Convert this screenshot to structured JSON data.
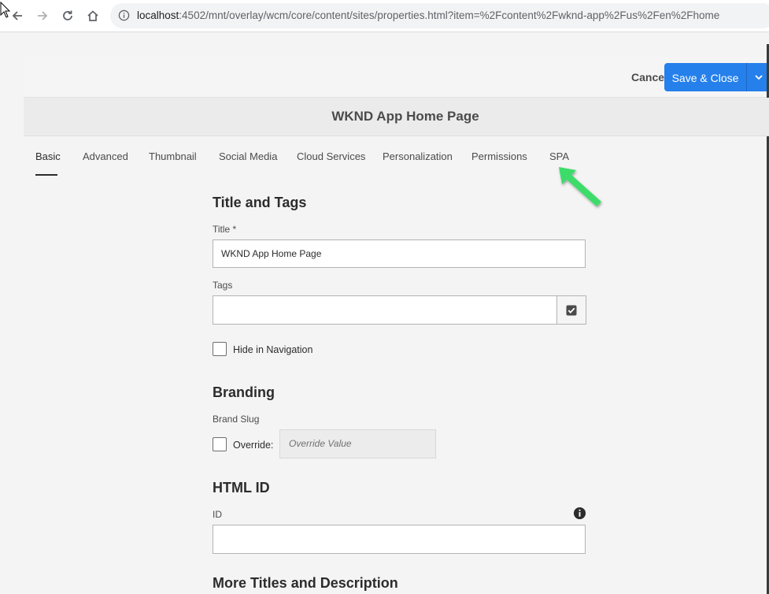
{
  "browser": {
    "url_host": "localhost",
    "url_path": ":4502/mnt/overlay/wcm/core/content/sites/properties.html?item=%2Fcontent%2Fwknd-app%2Fus%2Fen%2Fhome",
    "icons": [
      "back-icon",
      "forward-icon",
      "reload-icon",
      "home-icon",
      "info-icon"
    ]
  },
  "header": {
    "cancel_label": "Cancel",
    "save_label": "Save & Close",
    "page_title": "WKND App Home Page",
    "accent_color": "#2680eb"
  },
  "tabs": [
    {
      "label": "Basic",
      "active": true
    },
    {
      "label": "Advanced"
    },
    {
      "label": "Thumbnail"
    },
    {
      "label": "Social Media"
    },
    {
      "label": "Cloud Services"
    },
    {
      "label": "Personalization"
    },
    {
      "label": "Permissions"
    },
    {
      "label": "SPA"
    }
  ],
  "annotation": {
    "arrow_color": "#3ddc6b",
    "points_to": "SPA"
  },
  "form": {
    "title_and_tags": {
      "heading": "Title and Tags",
      "title_label": "Title *",
      "title_value": "WKND App Home Page",
      "tags_label": "Tags",
      "tags_value": "",
      "hide_in_nav_label": "Hide in Navigation",
      "hide_in_nav_checked": false
    },
    "branding": {
      "heading": "Branding",
      "brand_slug_label": "Brand Slug",
      "override_label": "Override:",
      "override_checked": false,
      "override_placeholder": "Override Value"
    },
    "html_id": {
      "heading": "HTML ID",
      "id_label": "ID",
      "id_value": ""
    },
    "more_titles": {
      "heading": "More Titles and Description"
    }
  }
}
